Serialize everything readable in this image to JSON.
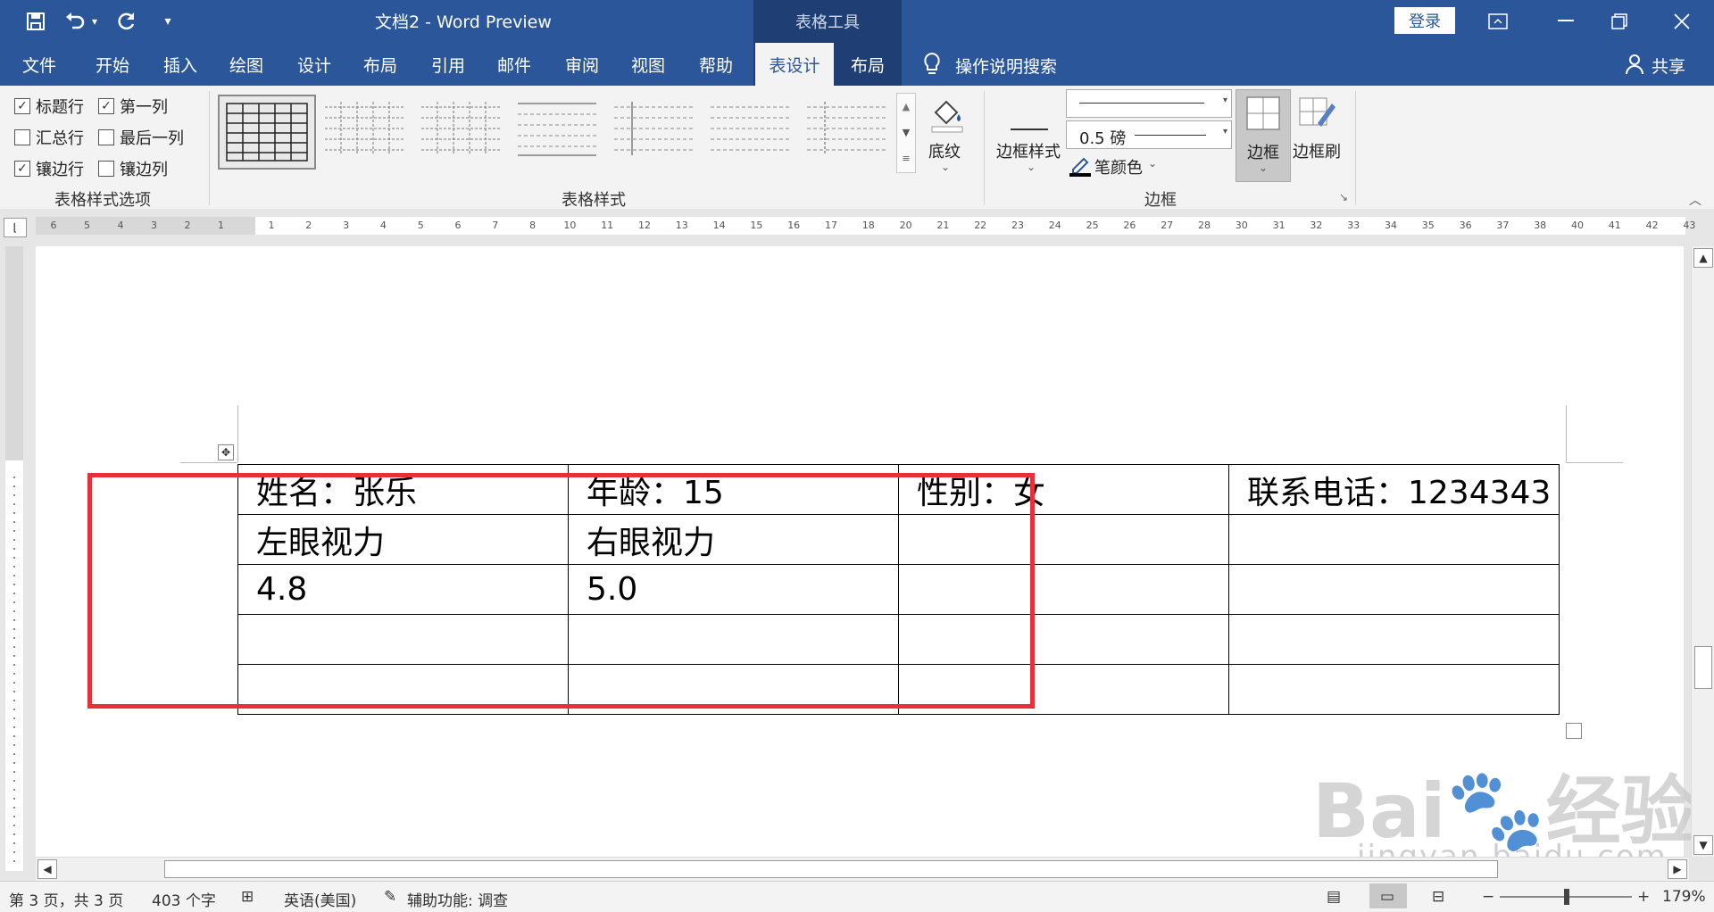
{
  "titlebar": {
    "doc_title": "文档2  -  Word Preview",
    "context_title": "表格工具",
    "login_button": "登录"
  },
  "tabs": [
    "文件",
    "开始",
    "插入",
    "绘图",
    "设计",
    "布局",
    "引用",
    "邮件",
    "审阅",
    "视图",
    "帮助",
    "表设计",
    "布局"
  ],
  "active_tab": "表设计",
  "search_label": "操作说明搜索",
  "share_label": "共享",
  "ribbon": {
    "style_options": {
      "items": [
        {
          "label": "标题行",
          "checked": true
        },
        {
          "label": "第一列",
          "checked": true
        },
        {
          "label": "汇总行",
          "checked": false
        },
        {
          "label": "最后一列",
          "checked": false
        },
        {
          "label": "镶边行",
          "checked": true
        },
        {
          "label": "镶边列",
          "checked": false
        }
      ],
      "group_label": "表格样式选项"
    },
    "table_styles_label": "表格样式",
    "shading_label": "底纹",
    "border_style_label": "边框样式",
    "pen_weight": "0.5 磅",
    "pen_color_label": "笔颜色",
    "borders_label": "边框",
    "border_painter_label": "边框刷",
    "borders_group_label": "边框"
  },
  "ruler": {
    "left_ticks": [
      "6",
      "5",
      "4",
      "3",
      "2",
      "1"
    ],
    "right_ticks": [
      "1",
      "2",
      "3",
      "4",
      "5",
      "6",
      "7",
      "8",
      "10",
      "11",
      "12",
      "13",
      "14",
      "15",
      "16",
      "17",
      "18",
      "20",
      "21",
      "22",
      "23",
      "24",
      "25",
      "26",
      "27",
      "28",
      "30",
      "31",
      "32",
      "33",
      "34",
      "35",
      "36",
      "37",
      "38",
      "40",
      "41",
      "42",
      "43"
    ]
  },
  "table": {
    "rows": [
      [
        "姓名：张乐",
        "年龄：15",
        "性别：女",
        "联系电话：1234343"
      ],
      [
        "左眼视力",
        "右眼视力",
        "",
        ""
      ],
      [
        "4.8",
        "5.0",
        "",
        ""
      ],
      [
        "",
        "",
        "",
        ""
      ],
      [
        "",
        "",
        "",
        ""
      ]
    ]
  },
  "status": {
    "page": "第 3 页，共 3 页",
    "words": "403 个字",
    "language": "英语(美国)",
    "accessibility": "辅助功能: 调查",
    "zoom": "179%"
  },
  "watermark": {
    "logo": "Bai 经验",
    "url": "jingyan.baidu.com"
  },
  "colors": {
    "accent": "#2b579a",
    "highlight_box": "#e8303a"
  }
}
